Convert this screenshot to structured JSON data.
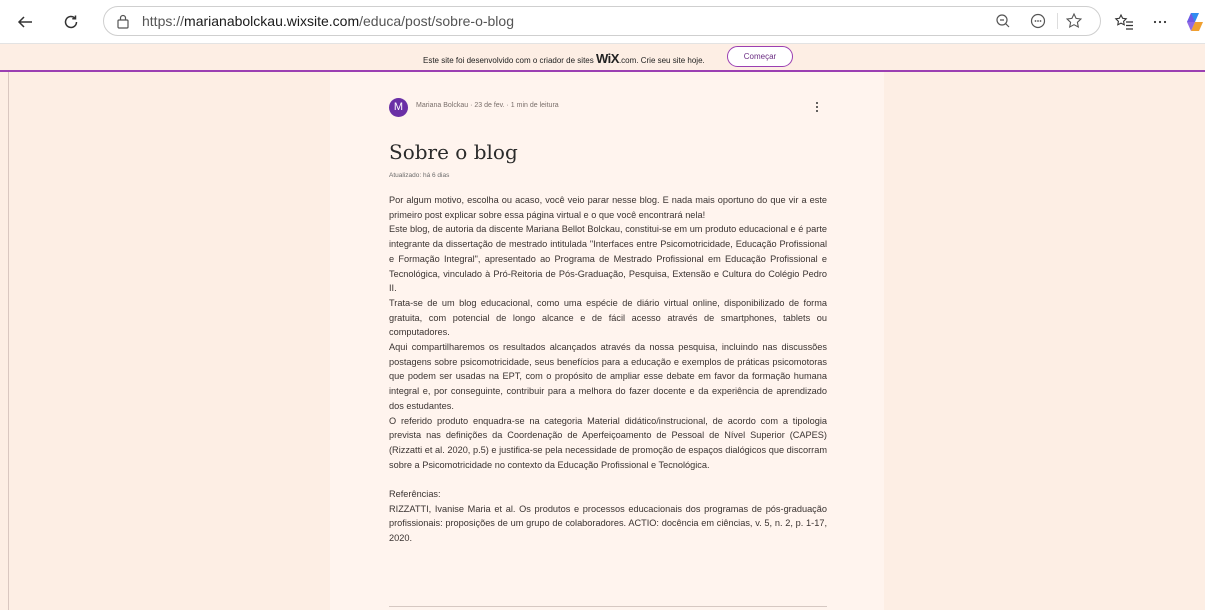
{
  "browser": {
    "url_prefix": "https://",
    "url_domain": "marianabolckau.wixsite.com",
    "url_path": "/educa/post/sobre-o-blog"
  },
  "wix_banner": {
    "message_before": "Este site foi desenvolvido com o criador de sites ",
    "brand": "WiX",
    "message_after": ".com. Crie seu site hoje.",
    "button_label": "Começar"
  },
  "post": {
    "avatar_initial": "M",
    "meta": "Mariana Bolckau  ·  23 de fev.  ·  1 min de leitura",
    "title": "Sobre o blog",
    "updated": "Atualizado: há 6 dias",
    "paragraphs": [
      "Por algum motivo, escolha ou acaso, você veio parar nesse blog. E nada mais oportuno do que vir a este primeiro post explicar sobre essa página virtual e o que você encontrará nela!",
      "Este blog, de autoria da discente Mariana Bellot Bolckau, constitui-se em um produto educacional e é parte integrante da dissertação de mestrado intitulada \"Interfaces entre Psicomotricidade, Educação Profissional e Formação Integral\", apresentado ao Programa de Mestrado Profissional em Educação Profissional e Tecnológica, vinculado à Pró-Reitoria de Pós-Graduação, Pesquisa, Extensão e Cultura do Colégio Pedro II.",
      "Trata-se de um blog educacional, como uma espécie de diário virtual online, disponibilizado de forma gratuita, com potencial de longo alcance e de fácil acesso através de smartphones, tablets ou computadores.",
      "Aqui compartilharemos os resultados alcançados através da nossa pesquisa, incluindo nas discussões postagens sobre psicomotricidade, seus benefícios para a educação e exemplos de práticas psicomotoras que podem ser usadas na EPT, com o propósito de ampliar esse debate em favor da formação humana integral e, por conseguinte, contribuir para a melhora do fazer docente e da experiência de aprendizado dos estudantes.",
      "O referido produto enquadra-se na categoria Material didático/instrucional, de acordo com a tipologia prevista nas definições da Coordenação de Aperfeiçoamento de Pessoal de Nível Superior (CAPES) (Rizzatti et al. 2020, p.5) e justifica-se pela necessidade de promoção de espaços dialógicos que discorram sobre a Psicomotricidade no contexto da Educação Profissional e Tecnológica."
    ],
    "references_heading": "Referências:",
    "reference": "RIZZATTI, Ivanise Maria et al. Os produtos e processos educacionais dos programas de pós-graduação profissionais: proposições de um grupo de colaboradores. ACTIO: docência em ciências, v. 5, n. 2, p. 1-17, 2020."
  }
}
